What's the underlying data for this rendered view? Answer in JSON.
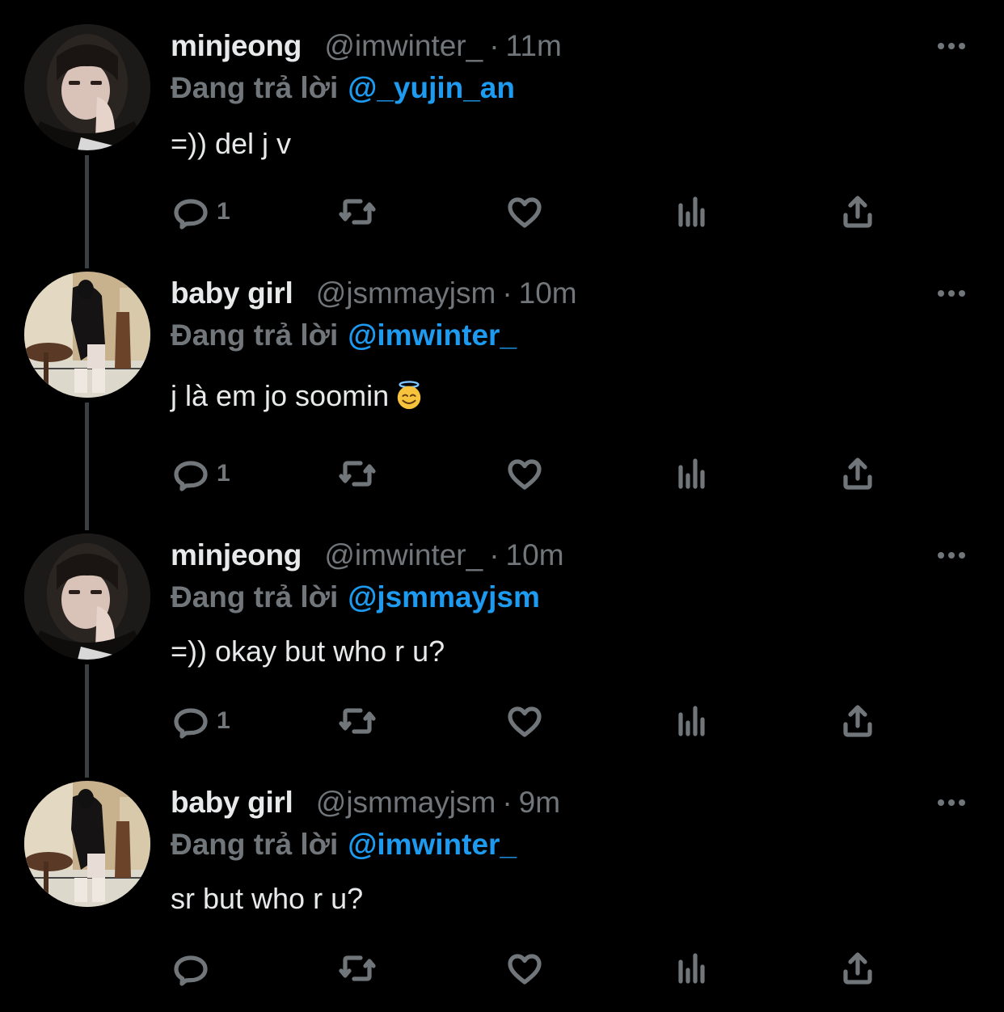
{
  "tweets": [
    {
      "name": "minjeong",
      "handle": "@imwinter_",
      "dot": "·",
      "time": "11m",
      "reply_prefix": "Đang trả lời",
      "reply_to": "@_yujin_an",
      "text": "=)) del j v",
      "reply_count": "1",
      "avatar": "minjeong-avatar"
    },
    {
      "name": "baby girl",
      "handle": "@jsmmayjsm",
      "dot": "·",
      "time": "10m",
      "reply_prefix": "Đang trả lời",
      "reply_to": "@imwinter_",
      "text": "j là em jo soomin",
      "emoji": "smiling-face-with-halo",
      "reply_count": "1",
      "avatar": "baby-girl-avatar"
    },
    {
      "name": "minjeong",
      "handle": "@imwinter_",
      "dot": "·",
      "time": "10m",
      "reply_prefix": "Đang trả lời",
      "reply_to": "@jsmmayjsm",
      "text": "=)) okay but who r u?",
      "reply_count": "1",
      "avatar": "minjeong-avatar"
    },
    {
      "name": "baby girl",
      "handle": "@jsmmayjsm",
      "dot": "·",
      "time": "9m",
      "reply_prefix": "Đang trả lời",
      "reply_to": "@imwinter_",
      "text": "sr but who r u?",
      "reply_count": "",
      "avatar": "baby-girl-avatar"
    }
  ],
  "colors": {
    "background": "#000000",
    "link": "#1d9bf0",
    "muted": "#71767b",
    "text": "#e7e9ea"
  },
  "icons": [
    "reply-icon",
    "retweet-icon",
    "like-icon",
    "views-icon",
    "share-icon",
    "more-icon"
  ]
}
